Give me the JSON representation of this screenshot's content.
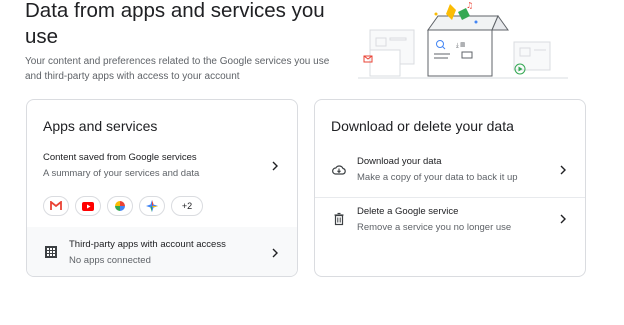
{
  "header": {
    "title": "Data from apps and services you use",
    "subtitle": "Your content and preferences related to the Google services you use and third-party apps with access to your account"
  },
  "apps_card": {
    "title": "Apps and services",
    "content_row": {
      "title": "Content saved from Google services",
      "description": "A summary of your services and data"
    },
    "chips": {
      "icons": [
        "gmail-icon",
        "youtube-icon",
        "photos-icon",
        "pay-icon"
      ],
      "more_label": "+2"
    },
    "third_party_row": {
      "title": "Third-party apps with account access",
      "description": "No apps connected"
    }
  },
  "download_card": {
    "title": "Download or delete your data",
    "download_row": {
      "title": "Download your data",
      "description": "Make a copy of your data to back it up"
    },
    "delete_row": {
      "title": "Delete a Google service",
      "description": "Remove a service you no longer use"
    }
  },
  "colors": {
    "text_primary": "#202124",
    "text_secondary": "#5f6368",
    "border": "#dadce0",
    "gmail_red": "#ea4335",
    "youtube_red": "#ff0000",
    "google_blue": "#4285f4",
    "google_yellow": "#fbbc04",
    "google_green": "#34a853"
  }
}
